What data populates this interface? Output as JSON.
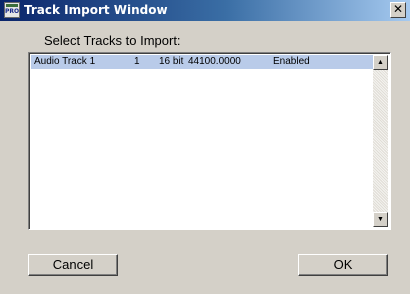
{
  "window": {
    "title": "Track Import Window",
    "app_icon_text": "PRO",
    "close_glyph": "✕",
    "close_icon": "close-icon"
  },
  "prompt": "Select Tracks to Import:",
  "tracks": [
    {
      "name": "Audio Track 1",
      "channel": "1",
      "bit_depth": "16 bit",
      "sample_rate": "44100.0000",
      "status": "Enabled",
      "selected": true
    }
  ],
  "scrollbar": {
    "up_glyph": "▲",
    "down_glyph": "▼"
  },
  "buttons": {
    "cancel": "Cancel",
    "ok": "OK"
  },
  "colors": {
    "selection": "#b9cbe9",
    "titlebar_start": "#0a246a",
    "face": "#d4d0c8"
  }
}
